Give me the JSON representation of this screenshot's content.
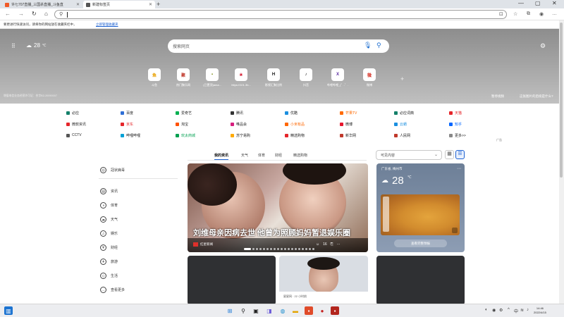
{
  "tabs": [
    {
      "title": "许七707直播_三国杀直播_斗鱼直",
      "active": false,
      "color": "#f05a28"
    },
    {
      "title": "新建标签页",
      "active": true,
      "color": "#555555"
    }
  ],
  "address": {
    "value": ""
  },
  "infobar": {
    "text": "要更进行快速访问，请将你的网站放在收藏夹栏中，",
    "link": "立即管理收藏夹"
  },
  "hero": {
    "temp": "28",
    "unit": "℃",
    "search_placeholder": "搜索网页",
    "icp": "增值电信业务经营许可证：合字B2-20090007",
    "right_link1": "暂停视频",
    "right_link2": "这张图片的后续是什么?"
  },
  "quick_links": [
    {
      "label": "斗鱼",
      "glyph": "鱼",
      "color": "#e8a000"
    },
    {
      "label": "热门聚乐网",
      "glyph": "聚",
      "color": "#c0392b"
    },
    {
      "label": "(已置顶)ama...",
      "glyph": "▪",
      "color": "#7a8a10"
    },
    {
      "label": "https://101.3b...",
      "glyph": "❀",
      "color": "#d0021b"
    },
    {
      "label": "影视汇聚比例",
      "glyph": "H",
      "color": "#111111"
    },
    {
      "label": "抖音",
      "glyph": "♪",
      "color": "#111111"
    },
    {
      "label": "哔哩哔哩_(゜-゜...",
      "glyph": "X",
      "color": "#5a2ca0"
    },
    {
      "label": "微博",
      "glyph": "微",
      "color": "#d52a1e"
    }
  ],
  "links": [
    [
      {
        "t": "必应",
        "c": "#14806a"
      },
      {
        "t": "百度",
        "c": "#2f6fd6"
      },
      {
        "t": "爱奇艺",
        "c": "#00b050"
      },
      {
        "t": "腾讯",
        "c": "#333333"
      },
      {
        "t": "优酷",
        "c": "#1a8fe0"
      },
      {
        "t": "芒果TV",
        "c": "#ff6a00"
      },
      {
        "t": "必应词典",
        "c": "#14806a"
      },
      {
        "t": "天猫",
        "c": "#e5252a"
      }
    ],
    [
      {
        "t": "微软资讯",
        "c": "#e5252a"
      },
      {
        "t": "京东",
        "c": "#e5252a"
      },
      {
        "t": "淘宝",
        "c": "#ff5000"
      },
      {
        "t": "唯品会",
        "c": "#d61e7e"
      },
      {
        "t": "小米有品",
        "c": "#ff6700"
      },
      {
        "t": "微博",
        "c": "#e6162d"
      },
      {
        "t": "云蜻",
        "c": "#1a8fe0"
      },
      {
        "t": "知乎",
        "c": "#0066ff"
      }
    ],
    [
      {
        "t": "CCTV",
        "c": "#555555"
      },
      {
        "t": "哔哩哔哩",
        "c": "#00a1d6"
      },
      {
        "t": "欢太商城",
        "c": "#00a050"
      },
      {
        "t": "苏宁易购",
        "c": "#ffaa00"
      },
      {
        "t": "精选购物",
        "c": "#e5252a"
      },
      {
        "t": "新华网",
        "c": "#c0392b"
      },
      {
        "t": "人民网",
        "c": "#c0392b"
      },
      {
        "t": "更多>>",
        "c": "#888888"
      }
    ]
  ],
  "ad_label": "广告",
  "sidebar": [
    {
      "label": "冠状病毒",
      "icon": "globe-icon",
      "g": "◎"
    },
    {
      "label": "资讯",
      "icon": "news-icon",
      "g": "▤"
    },
    {
      "label": "体育",
      "icon": "sports-icon",
      "g": "◑"
    },
    {
      "label": "天气",
      "icon": "weather-icon",
      "g": "☁"
    },
    {
      "label": "娱乐",
      "icon": "entertainment-icon",
      "g": "♫"
    },
    {
      "label": "财经",
      "icon": "finance-icon",
      "g": "¥"
    },
    {
      "label": "旅游",
      "icon": "travel-icon",
      "g": "✈"
    },
    {
      "label": "生活",
      "icon": "life-icon",
      "g": "◇"
    },
    {
      "label": "查看更多",
      "icon": "more-icon",
      "g": "…"
    }
  ],
  "feed_tabs": [
    "我的资讯",
    "天气",
    "体育",
    "财经",
    "精选购物"
  ],
  "dropdown": "可见内容",
  "article": {
    "headline": "刘维母亲因病去世 他曾为照顾妈妈暂退娱乐圈",
    "source": "红星新闻",
    "reactions": "16"
  },
  "weather": {
    "location": "广东省, 梅州市",
    "temp": "28",
    "unit": "℃",
    "detail": "",
    "button": "查看完整预报"
  },
  "card2_meta": "星星网 · 22 小时前",
  "clock": {
    "time": "14:46",
    "date": "2022/4/15"
  }
}
